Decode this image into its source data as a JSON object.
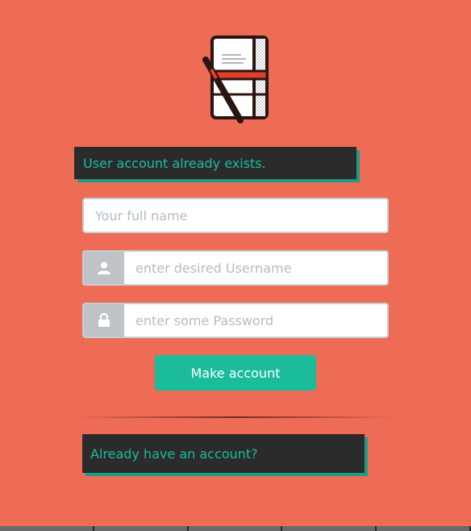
{
  "alert_message": "User account already exists.",
  "form": {
    "fullname_placeholder": "Your full name",
    "username_placeholder": "enter desired Username",
    "password_placeholder": "enter some Password",
    "submit_label": "Make account",
    "username_icon": "user-icon",
    "password_icon": "lock-icon"
  },
  "login_link": "Already have an account?",
  "colors": {
    "background": "#ee6b56",
    "accent": "#1abc9c",
    "dark": "#2b2b2b",
    "addon": "#bdc3c7"
  }
}
